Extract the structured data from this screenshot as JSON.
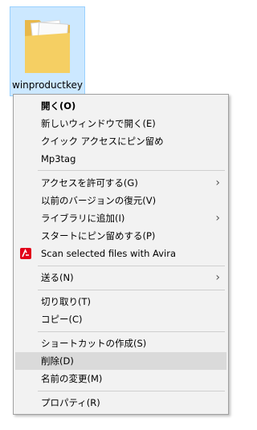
{
  "desktop": {
    "folder_label": "winproductkey"
  },
  "menu": {
    "items": [
      {
        "label": "開く(O)"
      },
      {
        "label": "新しいウィンドウで開く(E)"
      },
      {
        "label": "クイック アクセスにピン留め"
      },
      {
        "label": "Mp3tag"
      },
      {
        "label": "アクセスを許可する(G)"
      },
      {
        "label": "以前のバージョンの復元(V)"
      },
      {
        "label": "ライブラリに追加(I)"
      },
      {
        "label": "スタートにピン留めする(P)"
      },
      {
        "label": "Scan selected files with Avira"
      },
      {
        "label": "送る(N)"
      },
      {
        "label": "切り取り(T)"
      },
      {
        "label": "コピー(C)"
      },
      {
        "label": "ショートカットの作成(S)"
      },
      {
        "label": "削除(D)"
      },
      {
        "label": "名前の変更(M)"
      },
      {
        "label": "プロパティ(R)"
      }
    ],
    "submenu_arrow": "›"
  },
  "colors": {
    "selection_bg": "#cce8ff",
    "menu_bg": "#f2f2f2",
    "hover_bg": "#dadada",
    "avira_red": "#e2001a"
  }
}
